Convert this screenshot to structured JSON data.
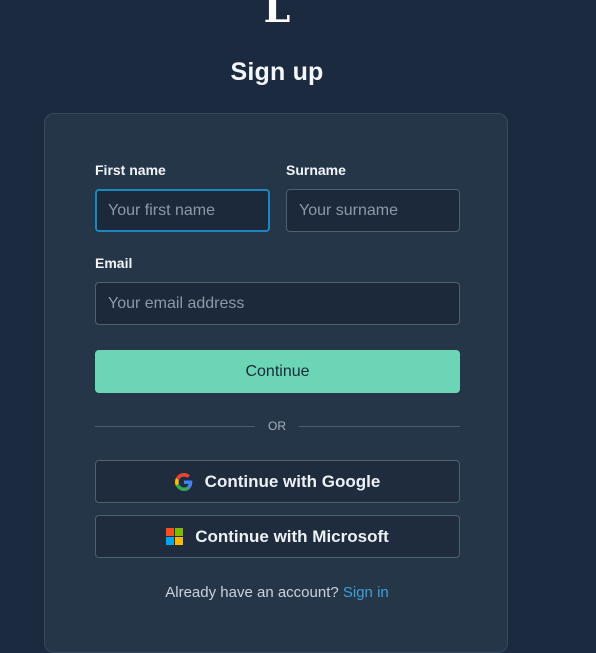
{
  "logo": {
    "text": "L"
  },
  "page": {
    "title": "Sign up"
  },
  "form": {
    "first_name": {
      "label": "First name",
      "placeholder": "Your first name",
      "value": ""
    },
    "surname": {
      "label": "Surname",
      "placeholder": "Your surname",
      "value": ""
    },
    "email": {
      "label": "Email",
      "placeholder": "Your email address",
      "value": ""
    },
    "continue_label": "Continue"
  },
  "divider": {
    "label": "OR"
  },
  "social": {
    "google": {
      "label": "Continue with Google",
      "icon": "google-icon"
    },
    "microsoft": {
      "label": "Continue with Microsoft",
      "icon": "microsoft-icon"
    }
  },
  "footer": {
    "prompt": "Already have an account?",
    "link_label": "Sign in"
  },
  "colors": {
    "background": "#1b2a3e",
    "card": "#263649",
    "accent": "#6bd5b6",
    "link": "#3d9fd6",
    "focus_ring": "#1c86bf"
  }
}
